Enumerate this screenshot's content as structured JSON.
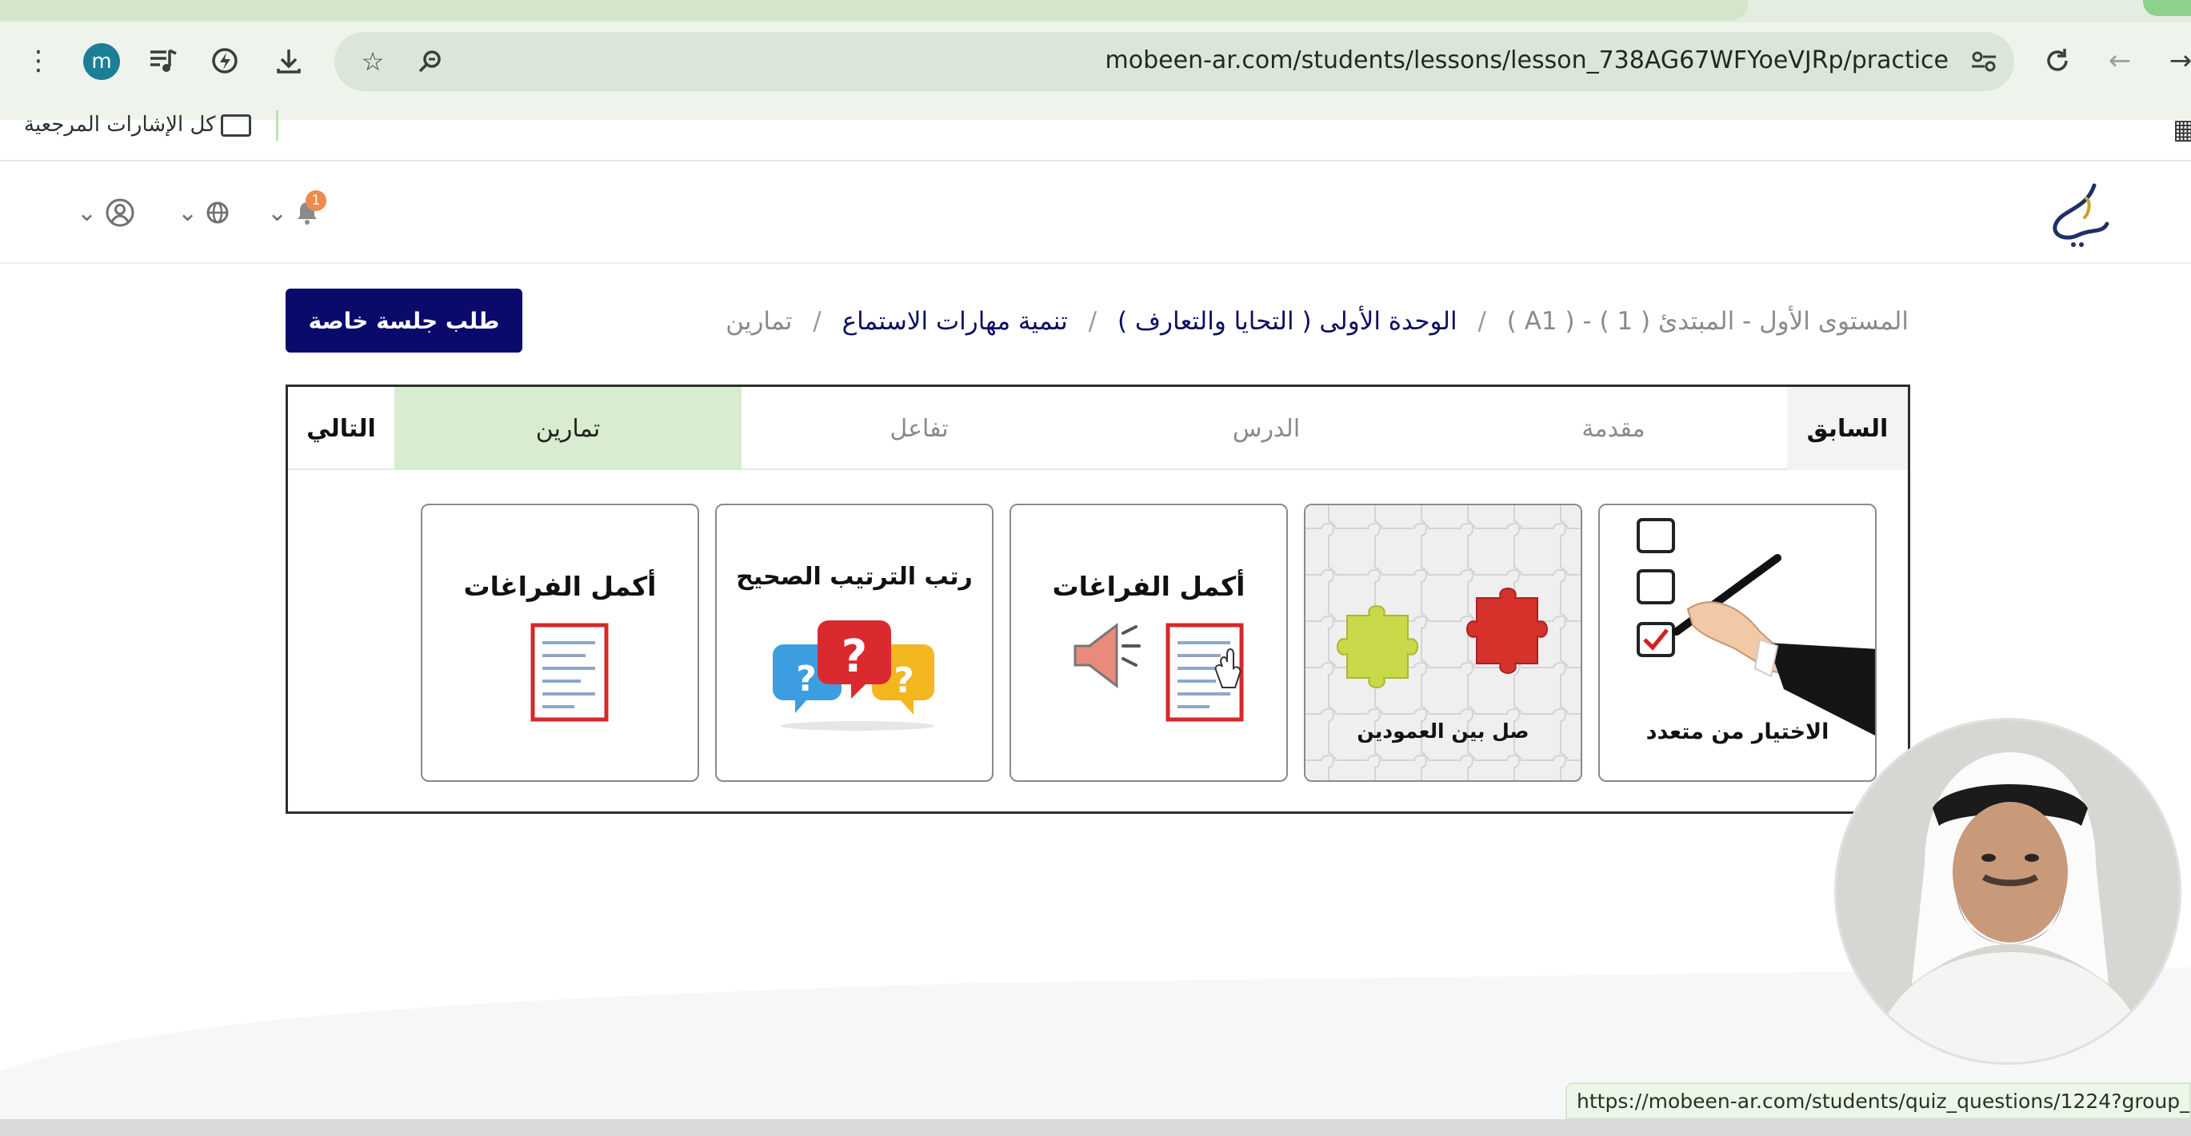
{
  "browser": {
    "avatar_letter": "m",
    "url": "mobeen-ar.com/students/lessons/lesson_738AG67WFYoeVJRp/practice",
    "bookmarks_label": "كل الإشارات المرجعية",
    "status_url": "https://mobeen-ar.com/students/quiz_questions/1224?group_id=1"
  },
  "header": {
    "notification_count": "1"
  },
  "breadcrumb": {
    "items": [
      "المستوى الأول - المبتدئ ( 1 ) - ( A1 )",
      "الوحدة الأولى ( التحايا والتعارف )",
      "تنمية مهارات الاستماع",
      "تمارين"
    ],
    "separator": "/"
  },
  "private_session_button": "طلب جلسة خاصة",
  "tabs": {
    "prev": "السابق",
    "intro": "مقدمة",
    "lesson": "الدرس",
    "interaction": "تفاعل",
    "exercises": "تمارين",
    "next": "التالي"
  },
  "cards": [
    {
      "title": "الاختيار من متعدد",
      "icon": "multiple-choice-icon"
    },
    {
      "title": "صل بين العمودين",
      "icon": "puzzle-icon"
    },
    {
      "title": "أكمل الفراغات",
      "icon": "audio-worksheet-icon"
    },
    {
      "title": "رتب الترتيب الصحيح",
      "icon": "question-bubbles-icon"
    },
    {
      "title": "أكمل الفراغات",
      "icon": "worksheet-icon"
    }
  ],
  "colors": {
    "primary_button": "#0a0a6b",
    "active_tab": "#d8eccf",
    "link": "#0c1060",
    "badge": "#f08a4b"
  }
}
